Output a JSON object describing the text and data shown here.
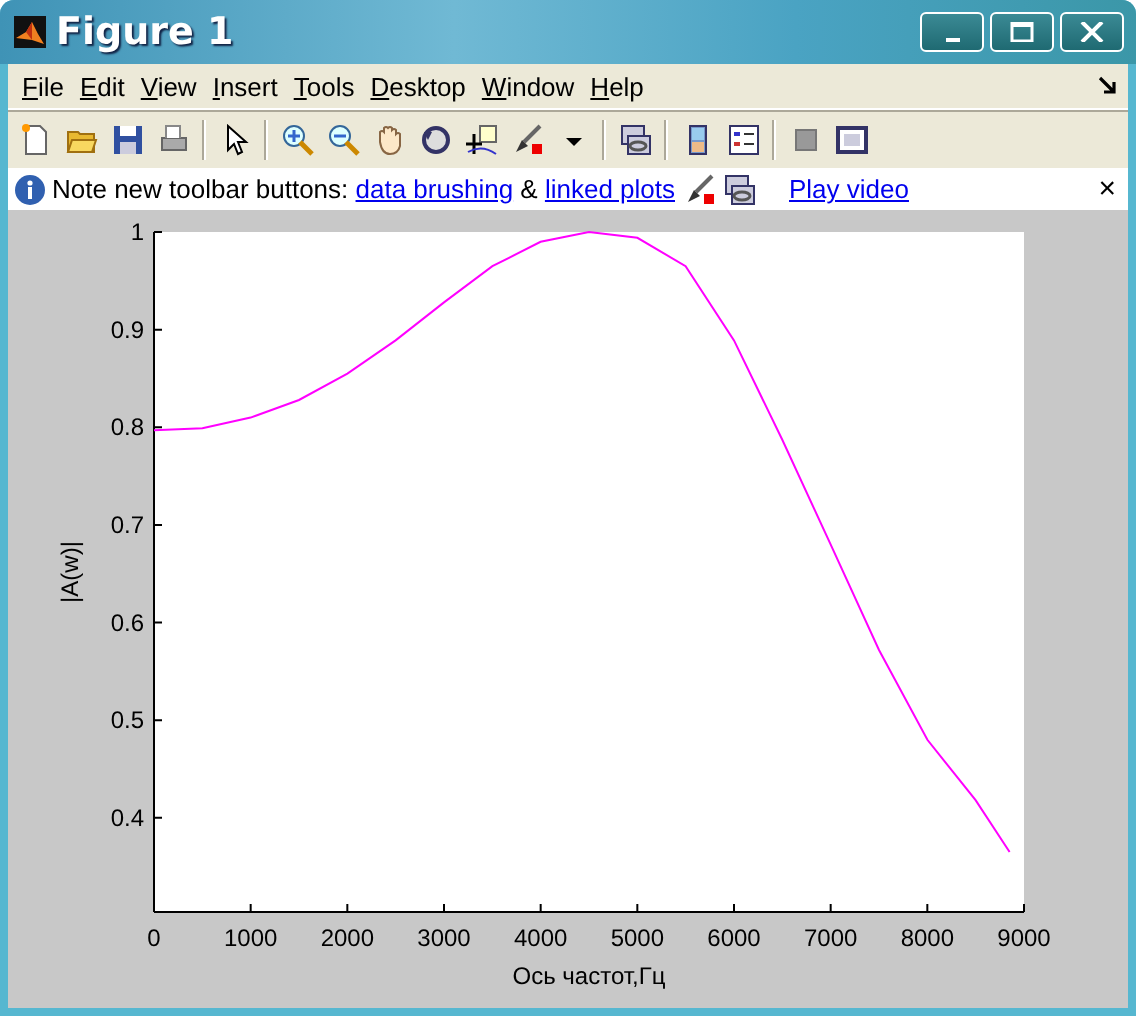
{
  "window": {
    "title": "Figure 1"
  },
  "menu": [
    {
      "label": "File"
    },
    {
      "label": "Edit"
    },
    {
      "label": "View"
    },
    {
      "label": "Insert"
    },
    {
      "label": "Tools"
    },
    {
      "label": "Desktop"
    },
    {
      "label": "Window"
    },
    {
      "label": "Help"
    }
  ],
  "info_bar": {
    "message": "Note new toolbar buttons:",
    "links": [
      "data brushing",
      "linked plots"
    ],
    "joiner": "&",
    "video_link": "Play video",
    "close": "×"
  },
  "plot": {
    "chart_data": {
      "type": "line",
      "xlabel": "Ось частот,Гц",
      "ylabel": "|A(w)|",
      "x": [
        0,
        500,
        1000,
        1500,
        2000,
        2500,
        3000,
        3500,
        4000,
        4500,
        5000,
        5500,
        6000,
        6500,
        7000,
        7500,
        8000,
        8500,
        8850
      ],
      "series": [
        {
          "color": "#ff00ff",
          "values": [
            0.797,
            0.799,
            0.81,
            0.828,
            0.855,
            0.889,
            0.928,
            0.965,
            0.99,
            1.0,
            0.994,
            0.965,
            0.889,
            0.787,
            0.68,
            0.572,
            0.48,
            0.418,
            0.365
          ]
        }
      ],
      "xlim": [
        0,
        9000
      ],
      "ylim": [
        0.3036,
        1
      ],
      "xticks": [
        0,
        1000,
        2000,
        3000,
        4000,
        5000,
        6000,
        7000,
        8000,
        9000
      ],
      "yticks": [
        0.4,
        0.5,
        0.6,
        0.7,
        0.8,
        0.9,
        {
          "value": 1,
          "label": "1"
        }
      ]
    }
  }
}
